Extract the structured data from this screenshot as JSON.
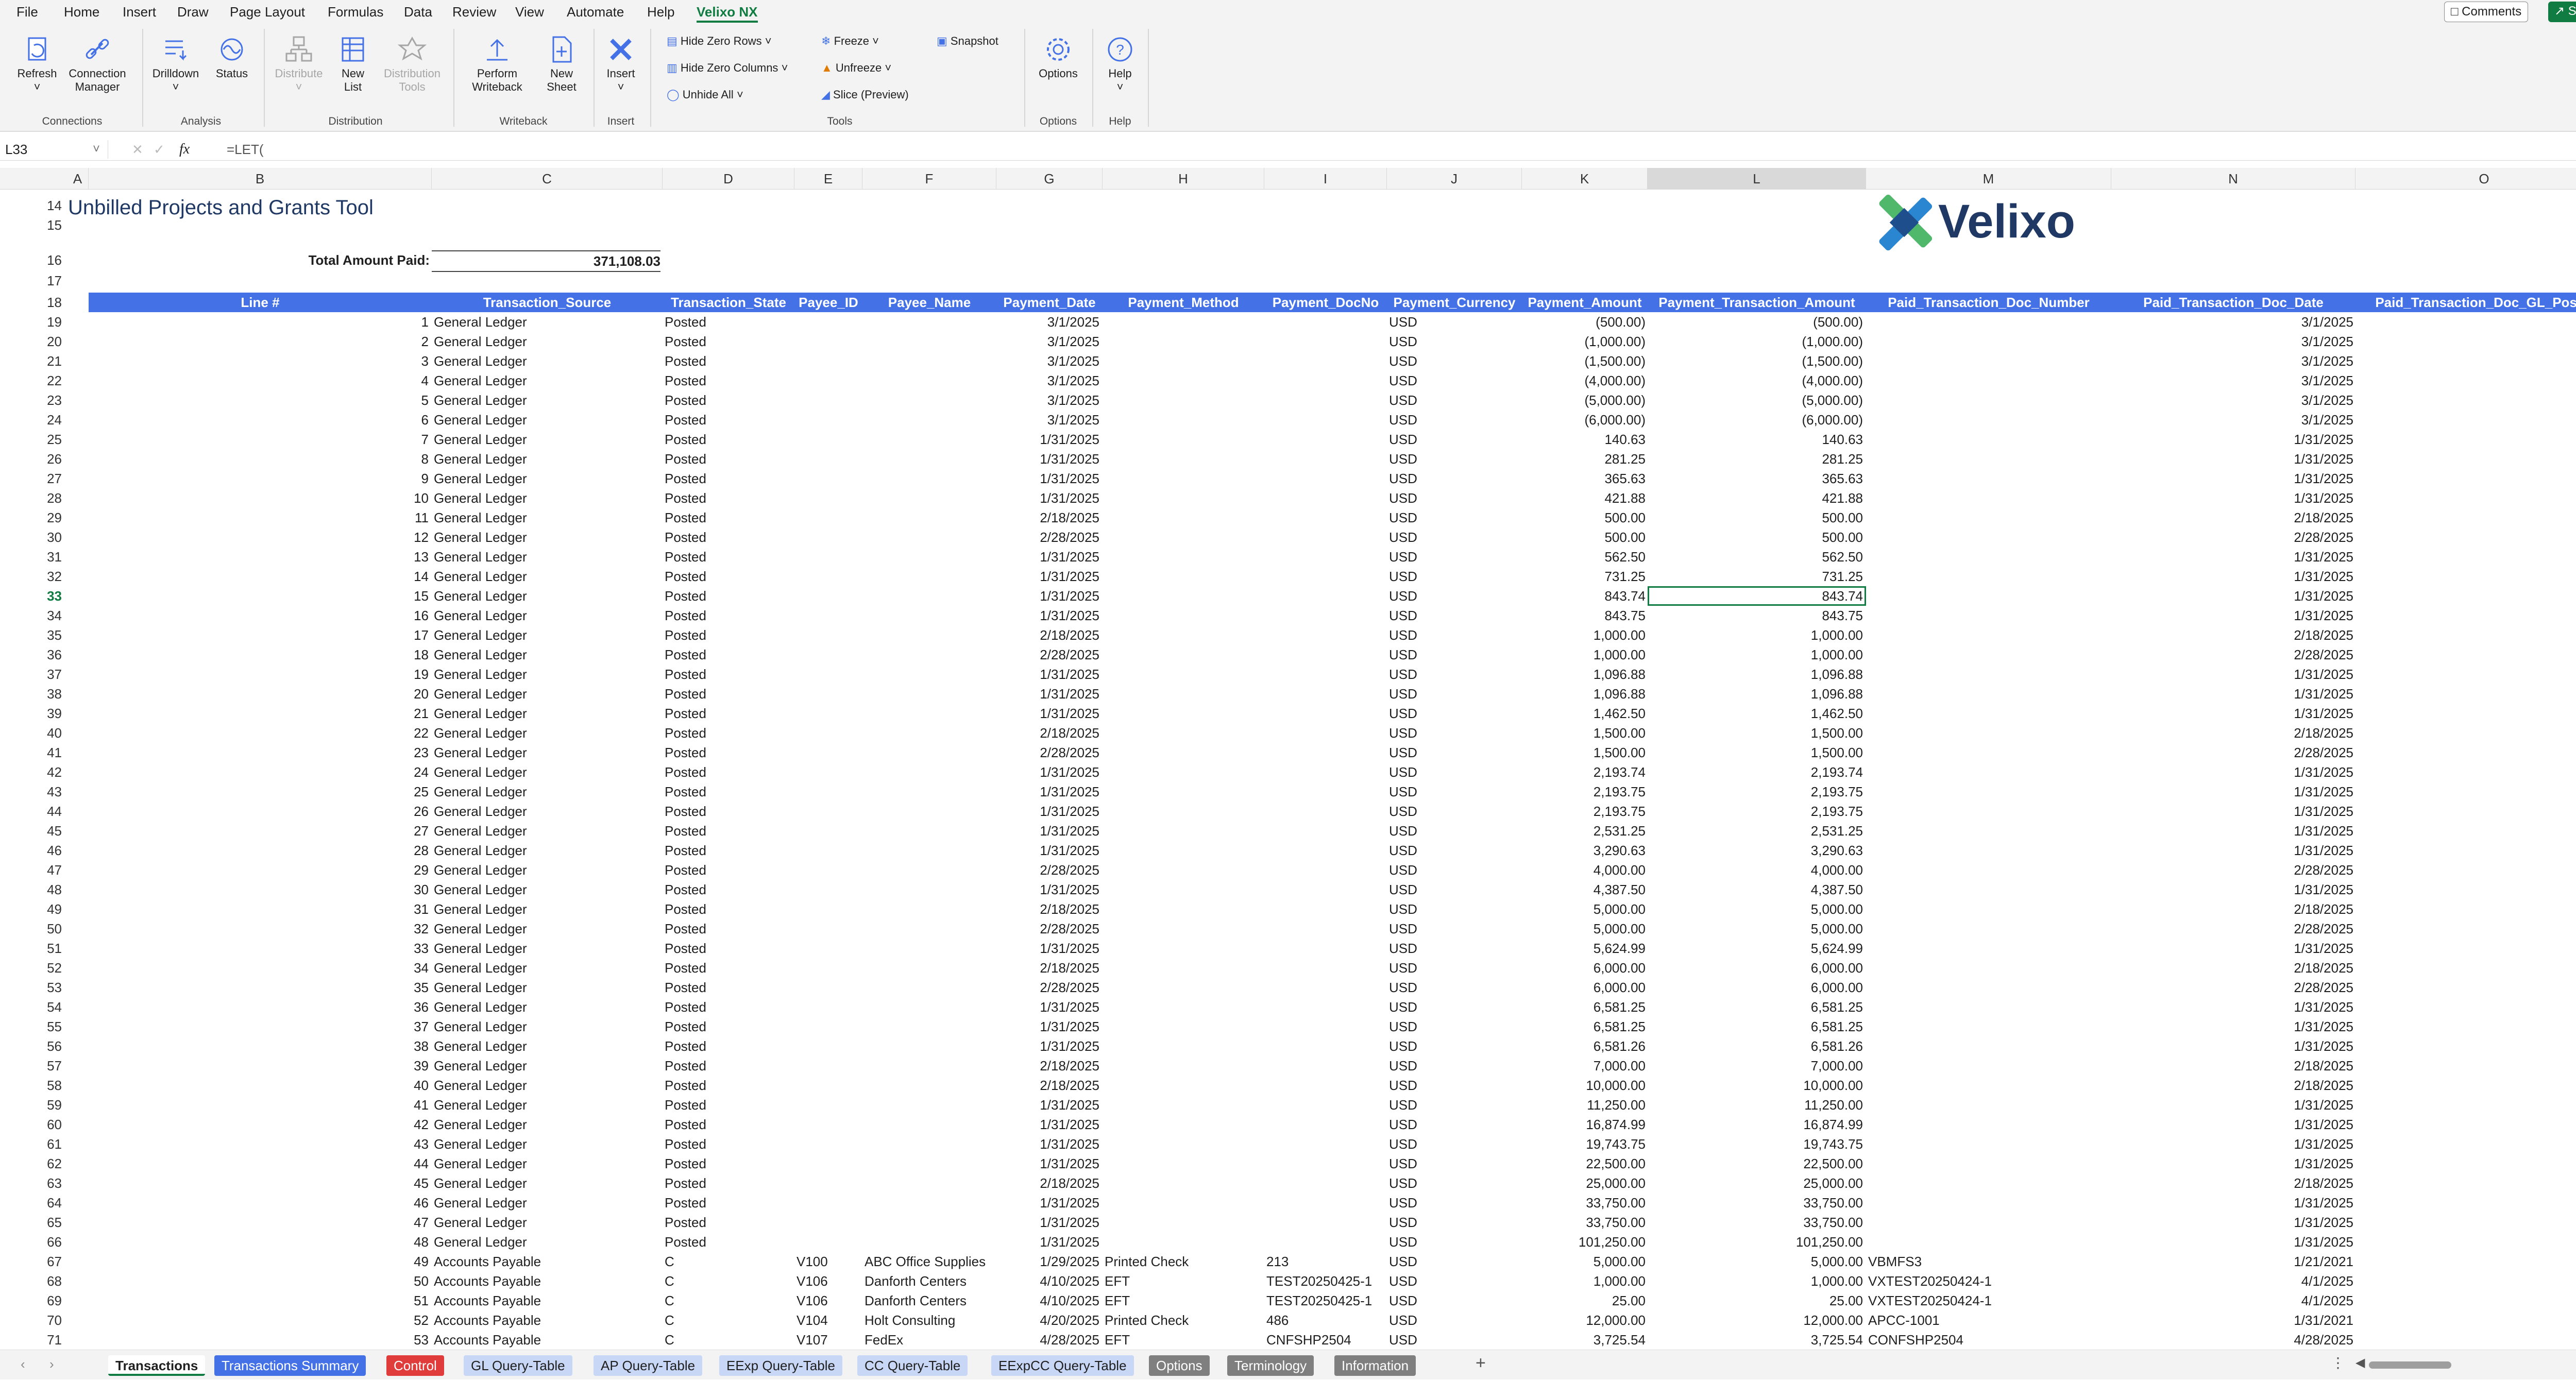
{
  "menu": {
    "items": [
      "File",
      "Home",
      "Insert",
      "Draw",
      "Page Layout",
      "Formulas",
      "Data",
      "Review",
      "View",
      "Automate",
      "Help",
      "Velixo NX"
    ],
    "active": "Velixo NX",
    "comments_label": "Comments",
    "share_label": "Share"
  },
  "ribbon": {
    "refresh": "Refresh",
    "connection_manager_1": "Connection",
    "connection_manager_2": "Manager",
    "drilldown": "Drilldown",
    "status": "Status",
    "distribute": "Distribute",
    "new_list_1": "New",
    "new_list_2": "List",
    "distribution_tools_1": "Distribution",
    "distribution_tools_2": "Tools",
    "perform_writeback_1": "Perform",
    "perform_writeback_2": "Writeback",
    "new_sheet_1": "New",
    "new_sheet_2": "Sheet",
    "insert": "Insert",
    "hide_zero_rows": "Hide Zero Rows",
    "hide_zero_columns": "Hide Zero Columns",
    "unhide_all": "Unhide All",
    "freeze": "Freeze",
    "unfreeze": "Unfreeze",
    "slice": "Slice (Preview)",
    "snapshot": "Snapshot",
    "options": "Options",
    "help": "Help",
    "groups": {
      "connections": "Connections",
      "analysis": "Analysis",
      "distribution": "Distribution",
      "writeback": "Writeback",
      "insert": "Insert",
      "tools": "Tools",
      "options": "Options",
      "help": "Help"
    }
  },
  "formula_bar": {
    "name_box": "L33",
    "fx": "fx",
    "formula": "=LET("
  },
  "columns": [
    "A",
    "B",
    "C",
    "D",
    "E",
    "F",
    "G",
    "H",
    "I",
    "J",
    "K",
    "L",
    "M",
    "N",
    "O"
  ],
  "selected_column": "L",
  "selected_row": "33",
  "sheet": {
    "title": "Unbilled Projects and Grants Tool",
    "total_label": "Total Amount Paid:",
    "total_value": "371,108.03",
    "logo_text": "Velixo",
    "top_rows": [
      "14",
      "15",
      "16",
      "17",
      "18"
    ],
    "headers": [
      "Line #",
      "Transaction_Source",
      "Transaction_State",
      "Payee_ID",
      "Payee_Name",
      "Payment_Date",
      "Payment_Method",
      "Payment_DocNo",
      "Payment_Currency",
      "Payment_Amount",
      "Payment_Transaction_Amount",
      "Paid_Transaction_Doc_Number",
      "Paid_Transaction_Doc_Date",
      "Paid_Transaction_Doc_GL_Postin"
    ],
    "rows": [
      [
        "19",
        "1",
        "General Ledger",
        "Posted",
        "",
        "",
        "3/1/2025",
        "",
        "",
        "USD",
        "(500.00)",
        "(500.00)",
        "",
        "3/1/2025"
      ],
      [
        "20",
        "2",
        "General Ledger",
        "Posted",
        "",
        "",
        "3/1/2025",
        "",
        "",
        "USD",
        "(1,000.00)",
        "(1,000.00)",
        "",
        "3/1/2025"
      ],
      [
        "21",
        "3",
        "General Ledger",
        "Posted",
        "",
        "",
        "3/1/2025",
        "",
        "",
        "USD",
        "(1,500.00)",
        "(1,500.00)",
        "",
        "3/1/2025"
      ],
      [
        "22",
        "4",
        "General Ledger",
        "Posted",
        "",
        "",
        "3/1/2025",
        "",
        "",
        "USD",
        "(4,000.00)",
        "(4,000.00)",
        "",
        "3/1/2025"
      ],
      [
        "23",
        "5",
        "General Ledger",
        "Posted",
        "",
        "",
        "3/1/2025",
        "",
        "",
        "USD",
        "(5,000.00)",
        "(5,000.00)",
        "",
        "3/1/2025"
      ],
      [
        "24",
        "6",
        "General Ledger",
        "Posted",
        "",
        "",
        "3/1/2025",
        "",
        "",
        "USD",
        "(6,000.00)",
        "(6,000.00)",
        "",
        "3/1/2025"
      ],
      [
        "25",
        "7",
        "General Ledger",
        "Posted",
        "",
        "",
        "1/31/2025",
        "",
        "",
        "USD",
        "140.63",
        "140.63",
        "",
        "1/31/2025"
      ],
      [
        "26",
        "8",
        "General Ledger",
        "Posted",
        "",
        "",
        "1/31/2025",
        "",
        "",
        "USD",
        "281.25",
        "281.25",
        "",
        "1/31/2025"
      ],
      [
        "27",
        "9",
        "General Ledger",
        "Posted",
        "",
        "",
        "1/31/2025",
        "",
        "",
        "USD",
        "365.63",
        "365.63",
        "",
        "1/31/2025"
      ],
      [
        "28",
        "10",
        "General Ledger",
        "Posted",
        "",
        "",
        "1/31/2025",
        "",
        "",
        "USD",
        "421.88",
        "421.88",
        "",
        "1/31/2025"
      ],
      [
        "29",
        "11",
        "General Ledger",
        "Posted",
        "",
        "",
        "2/18/2025",
        "",
        "",
        "USD",
        "500.00",
        "500.00",
        "",
        "2/18/2025"
      ],
      [
        "30",
        "12",
        "General Ledger",
        "Posted",
        "",
        "",
        "2/28/2025",
        "",
        "",
        "USD",
        "500.00",
        "500.00",
        "",
        "2/28/2025"
      ],
      [
        "31",
        "13",
        "General Ledger",
        "Posted",
        "",
        "",
        "1/31/2025",
        "",
        "",
        "USD",
        "562.50",
        "562.50",
        "",
        "1/31/2025"
      ],
      [
        "32",
        "14",
        "General Ledger",
        "Posted",
        "",
        "",
        "1/31/2025",
        "",
        "",
        "USD",
        "731.25",
        "731.25",
        "",
        "1/31/2025"
      ],
      [
        "33",
        "15",
        "General Ledger",
        "Posted",
        "",
        "",
        "1/31/2025",
        "",
        "",
        "USD",
        "843.74",
        "843.74",
        "",
        "1/31/2025"
      ],
      [
        "34",
        "16",
        "General Ledger",
        "Posted",
        "",
        "",
        "1/31/2025",
        "",
        "",
        "USD",
        "843.75",
        "843.75",
        "",
        "1/31/2025"
      ],
      [
        "35",
        "17",
        "General Ledger",
        "Posted",
        "",
        "",
        "2/18/2025",
        "",
        "",
        "USD",
        "1,000.00",
        "1,000.00",
        "",
        "2/18/2025"
      ],
      [
        "36",
        "18",
        "General Ledger",
        "Posted",
        "",
        "",
        "2/28/2025",
        "",
        "",
        "USD",
        "1,000.00",
        "1,000.00",
        "",
        "2/28/2025"
      ],
      [
        "37",
        "19",
        "General Ledger",
        "Posted",
        "",
        "",
        "1/31/2025",
        "",
        "",
        "USD",
        "1,096.88",
        "1,096.88",
        "",
        "1/31/2025"
      ],
      [
        "38",
        "20",
        "General Ledger",
        "Posted",
        "",
        "",
        "1/31/2025",
        "",
        "",
        "USD",
        "1,096.88",
        "1,096.88",
        "",
        "1/31/2025"
      ],
      [
        "39",
        "21",
        "General Ledger",
        "Posted",
        "",
        "",
        "1/31/2025",
        "",
        "",
        "USD",
        "1,462.50",
        "1,462.50",
        "",
        "1/31/2025"
      ],
      [
        "40",
        "22",
        "General Ledger",
        "Posted",
        "",
        "",
        "2/18/2025",
        "",
        "",
        "USD",
        "1,500.00",
        "1,500.00",
        "",
        "2/18/2025"
      ],
      [
        "41",
        "23",
        "General Ledger",
        "Posted",
        "",
        "",
        "2/28/2025",
        "",
        "",
        "USD",
        "1,500.00",
        "1,500.00",
        "",
        "2/28/2025"
      ],
      [
        "42",
        "24",
        "General Ledger",
        "Posted",
        "",
        "",
        "1/31/2025",
        "",
        "",
        "USD",
        "2,193.74",
        "2,193.74",
        "",
        "1/31/2025"
      ],
      [
        "43",
        "25",
        "General Ledger",
        "Posted",
        "",
        "",
        "1/31/2025",
        "",
        "",
        "USD",
        "2,193.75",
        "2,193.75",
        "",
        "1/31/2025"
      ],
      [
        "44",
        "26",
        "General Ledger",
        "Posted",
        "",
        "",
        "1/31/2025",
        "",
        "",
        "USD",
        "2,193.75",
        "2,193.75",
        "",
        "1/31/2025"
      ],
      [
        "45",
        "27",
        "General Ledger",
        "Posted",
        "",
        "",
        "1/31/2025",
        "",
        "",
        "USD",
        "2,531.25",
        "2,531.25",
        "",
        "1/31/2025"
      ],
      [
        "46",
        "28",
        "General Ledger",
        "Posted",
        "",
        "",
        "1/31/2025",
        "",
        "",
        "USD",
        "3,290.63",
        "3,290.63",
        "",
        "1/31/2025"
      ],
      [
        "47",
        "29",
        "General Ledger",
        "Posted",
        "",
        "",
        "2/28/2025",
        "",
        "",
        "USD",
        "4,000.00",
        "4,000.00",
        "",
        "2/28/2025"
      ],
      [
        "48",
        "30",
        "General Ledger",
        "Posted",
        "",
        "",
        "1/31/2025",
        "",
        "",
        "USD",
        "4,387.50",
        "4,387.50",
        "",
        "1/31/2025"
      ],
      [
        "49",
        "31",
        "General Ledger",
        "Posted",
        "",
        "",
        "2/18/2025",
        "",
        "",
        "USD",
        "5,000.00",
        "5,000.00",
        "",
        "2/18/2025"
      ],
      [
        "50",
        "32",
        "General Ledger",
        "Posted",
        "",
        "",
        "2/28/2025",
        "",
        "",
        "USD",
        "5,000.00",
        "5,000.00",
        "",
        "2/28/2025"
      ],
      [
        "51",
        "33",
        "General Ledger",
        "Posted",
        "",
        "",
        "1/31/2025",
        "",
        "",
        "USD",
        "5,624.99",
        "5,624.99",
        "",
        "1/31/2025"
      ],
      [
        "52",
        "34",
        "General Ledger",
        "Posted",
        "",
        "",
        "2/18/2025",
        "",
        "",
        "USD",
        "6,000.00",
        "6,000.00",
        "",
        "2/18/2025"
      ],
      [
        "53",
        "35",
        "General Ledger",
        "Posted",
        "",
        "",
        "2/28/2025",
        "",
        "",
        "USD",
        "6,000.00",
        "6,000.00",
        "",
        "2/28/2025"
      ],
      [
        "54",
        "36",
        "General Ledger",
        "Posted",
        "",
        "",
        "1/31/2025",
        "",
        "",
        "USD",
        "6,581.25",
        "6,581.25",
        "",
        "1/31/2025"
      ],
      [
        "55",
        "37",
        "General Ledger",
        "Posted",
        "",
        "",
        "1/31/2025",
        "",
        "",
        "USD",
        "6,581.25",
        "6,581.25",
        "",
        "1/31/2025"
      ],
      [
        "56",
        "38",
        "General Ledger",
        "Posted",
        "",
        "",
        "1/31/2025",
        "",
        "",
        "USD",
        "6,581.26",
        "6,581.26",
        "",
        "1/31/2025"
      ],
      [
        "57",
        "39",
        "General Ledger",
        "Posted",
        "",
        "",
        "2/18/2025",
        "",
        "",
        "USD",
        "7,000.00",
        "7,000.00",
        "",
        "2/18/2025"
      ],
      [
        "58",
        "40",
        "General Ledger",
        "Posted",
        "",
        "",
        "2/18/2025",
        "",
        "",
        "USD",
        "10,000.00",
        "10,000.00",
        "",
        "2/18/2025"
      ],
      [
        "59",
        "41",
        "General Ledger",
        "Posted",
        "",
        "",
        "1/31/2025",
        "",
        "",
        "USD",
        "11,250.00",
        "11,250.00",
        "",
        "1/31/2025"
      ],
      [
        "60",
        "42",
        "General Ledger",
        "Posted",
        "",
        "",
        "1/31/2025",
        "",
        "",
        "USD",
        "16,874.99",
        "16,874.99",
        "",
        "1/31/2025"
      ],
      [
        "61",
        "43",
        "General Ledger",
        "Posted",
        "",
        "",
        "1/31/2025",
        "",
        "",
        "USD",
        "19,743.75",
        "19,743.75",
        "",
        "1/31/2025"
      ],
      [
        "62",
        "44",
        "General Ledger",
        "Posted",
        "",
        "",
        "1/31/2025",
        "",
        "",
        "USD",
        "22,500.00",
        "22,500.00",
        "",
        "1/31/2025"
      ],
      [
        "63",
        "45",
        "General Ledger",
        "Posted",
        "",
        "",
        "2/18/2025",
        "",
        "",
        "USD",
        "25,000.00",
        "25,000.00",
        "",
        "2/18/2025"
      ],
      [
        "64",
        "46",
        "General Ledger",
        "Posted",
        "",
        "",
        "1/31/2025",
        "",
        "",
        "USD",
        "33,750.00",
        "33,750.00",
        "",
        "1/31/2025"
      ],
      [
        "65",
        "47",
        "General Ledger",
        "Posted",
        "",
        "",
        "1/31/2025",
        "",
        "",
        "USD",
        "33,750.00",
        "33,750.00",
        "",
        "1/31/2025"
      ],
      [
        "66",
        "48",
        "General Ledger",
        "Posted",
        "",
        "",
        "1/31/2025",
        "",
        "",
        "USD",
        "101,250.00",
        "101,250.00",
        "",
        "1/31/2025"
      ],
      [
        "67",
        "49",
        "Accounts Payable",
        "C",
        "V100",
        "ABC Office Supplies",
        "1/29/2025",
        "Printed Check",
        "213",
        "USD",
        "5,000.00",
        "5,000.00",
        "VBMFS3",
        "1/21/2021"
      ],
      [
        "68",
        "50",
        "Accounts Payable",
        "C",
        "V106",
        "Danforth Centers",
        "4/10/2025",
        "EFT",
        "TEST20250425-1",
        "USD",
        "1,000.00",
        "1,000.00",
        "VXTEST20250424-1",
        "4/1/2025"
      ],
      [
        "69",
        "51",
        "Accounts Payable",
        "C",
        "V106",
        "Danforth Centers",
        "4/10/2025",
        "EFT",
        "TEST20250425-1",
        "USD",
        "25.00",
        "25.00",
        "VXTEST20250424-1",
        "4/1/2025"
      ],
      [
        "70",
        "52",
        "Accounts Payable",
        "C",
        "V104",
        "Holt Consulting",
        "4/20/2025",
        "Printed Check",
        "486",
        "USD",
        "12,000.00",
        "12,000.00",
        "APCC-1001",
        "1/31/2021"
      ],
      [
        "71",
        "53",
        "Accounts Payable",
        "C",
        "V107",
        "FedEx",
        "4/28/2025",
        "EFT",
        "CNFSHP2504",
        "USD",
        "3,725.54",
        "3,725.54",
        "CONFSHP2504",
        "4/28/2025"
      ]
    ]
  },
  "tabs": [
    {
      "label": "Transactions",
      "style": "active"
    },
    {
      "label": "Transactions Summary",
      "style": "blue"
    },
    {
      "label": "Control",
      "style": "red"
    },
    {
      "label": "GL Query-Table",
      "style": "lightblue"
    },
    {
      "label": "AP Query-Table",
      "style": "lightblue"
    },
    {
      "label": "EExp Query-Table",
      "style": "lightblue"
    },
    {
      "label": "CC Query-Table",
      "style": "lightblue"
    },
    {
      "label": "EExpCC Query-Table",
      "style": "lightblue"
    },
    {
      "label": "Options",
      "style": "gray"
    },
    {
      "label": "Terminology",
      "style": "gray"
    },
    {
      "label": "Information",
      "style": "gray"
    }
  ],
  "colors": {
    "header_band": "#4472e6",
    "excel_green": "#107c41",
    "tab_blue": "#4472e6",
    "tab_red": "#e03c3c",
    "tab_lightblue": "#c9d7f7",
    "tab_gray": "#7f7f7f"
  }
}
